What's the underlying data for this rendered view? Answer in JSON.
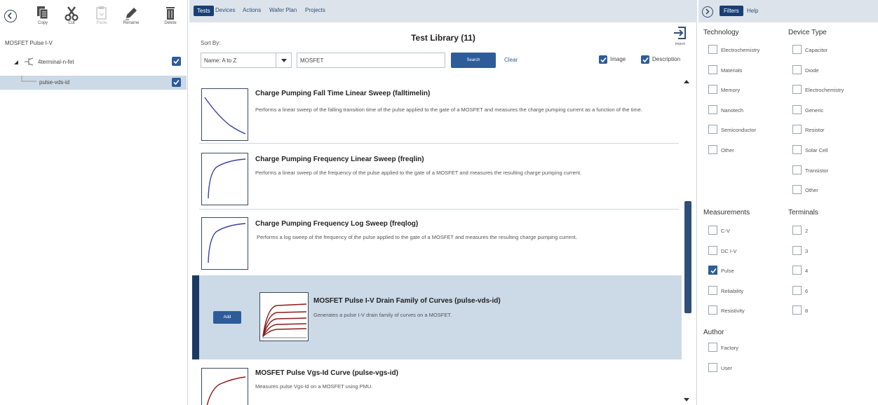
{
  "toolbar": {
    "copy": "Copy",
    "cut": "Cut",
    "paste": "Paste",
    "rename": "Rename",
    "delete": "Delete"
  },
  "session": {
    "title": "MOSFET Pulse I-V",
    "tree": [
      {
        "label": "4terminal-n-fet",
        "checked": true
      },
      {
        "label": "pulse-vds-id",
        "checked": true
      }
    ]
  },
  "tabs": [
    "Tests",
    "Devices",
    "Actions",
    "Wafer Plan",
    "Projects"
  ],
  "library": {
    "title": "Test Library (11)",
    "import_label": "Import",
    "sort_by_label": "Sort By:",
    "sort_value": "Name: A to Z",
    "search_value": "MOSFET",
    "search_button": "Search",
    "clear_button": "Clear",
    "image_option": "Image",
    "description_option": "Description"
  },
  "tests": [
    {
      "title": "Charge Pumping Fall Time Linear Sweep (falltimelin)",
      "description": "Performs a linear sweep of the falling transition time of the pulse applied to the gate of a MOSFET and measures the charge pumping current as a function of the time.",
      "icon": "decay-curve-thumbnail"
    },
    {
      "title": "Charge Pumping Frequency Linear Sweep (freqlin)",
      "description": "Performs a linear sweep of the frequency of the pulse applied to the gate of a MOSFET and measures the resulting charge pumping current.",
      "icon": "rise-curve-thumbnail"
    },
    {
      "title": "Charge Pumping Frequency Log Sweep (freqlog)",
      "description": "Performs a log sweep of the frequency of the pulse applied to the gate of a MOSFET and measures the resulting charge pumping current.",
      "icon": "rise-curve-thumbnail"
    },
    {
      "title": "MOSFET Pulse I-V Drain Family of Curves (pulse-vds-id)",
      "description": "Generates a pulse I-V drain family of curves on a MOSFET.",
      "icon": "family-curves-thumbnail",
      "add_button": "Add",
      "selected": true
    },
    {
      "title": "MOSFET Pulse Vgs-Id Curve (pulse-vgs-id)",
      "description": "Measures pulse Vgs-Id on a MOSFET using PMU.",
      "icon": "vgs-id-thumbnail"
    }
  ],
  "right_tabs": [
    "Filters",
    "Help"
  ],
  "filters": {
    "technology": {
      "label": "Technology",
      "options": [
        {
          "label": "Electrochemistry",
          "checked": false
        },
        {
          "label": "Materials",
          "checked": false
        },
        {
          "label": "Memory",
          "checked": false
        },
        {
          "label": "Nanotech",
          "checked": false
        },
        {
          "label": "Semiconductor",
          "checked": false
        },
        {
          "label": "Other",
          "checked": false
        }
      ]
    },
    "device_type": {
      "label": "Device Type",
      "options": [
        {
          "label": "Capacitor",
          "checked": false
        },
        {
          "label": "Diode",
          "checked": false
        },
        {
          "label": "Electrochemistry",
          "checked": false
        },
        {
          "label": "Generic",
          "checked": false
        },
        {
          "label": "Resistor",
          "checked": false
        },
        {
          "label": "Solar Cell",
          "checked": false
        },
        {
          "label": "Transistor",
          "checked": false
        },
        {
          "label": "Other",
          "checked": false
        }
      ]
    },
    "measurements": {
      "label": "Measurements",
      "options": [
        {
          "label": "C-V",
          "checked": false
        },
        {
          "label": "DC I-V",
          "checked": false
        },
        {
          "label": "Pulse",
          "checked": true
        },
        {
          "label": "Reliability",
          "checked": false
        },
        {
          "label": "Resistivity",
          "checked": false
        }
      ]
    },
    "terminals": {
      "label": "Terminals",
      "options": [
        {
          "label": "2",
          "checked": false
        },
        {
          "label": "3",
          "checked": false
        },
        {
          "label": "4",
          "checked": false
        },
        {
          "label": "6",
          "checked": false
        },
        {
          "label": "8",
          "checked": false
        }
      ]
    },
    "author": {
      "label": "Author",
      "options": [
        {
          "label": "Factory",
          "checked": false
        },
        {
          "label": "User",
          "checked": false
        }
      ]
    }
  },
  "colors": {
    "primary": "#2e5c99",
    "tab_active": "#193f75",
    "selected_row": "#ccd9e6",
    "curve": "#3b3fa8",
    "family_curve": "#8b1a1a"
  }
}
